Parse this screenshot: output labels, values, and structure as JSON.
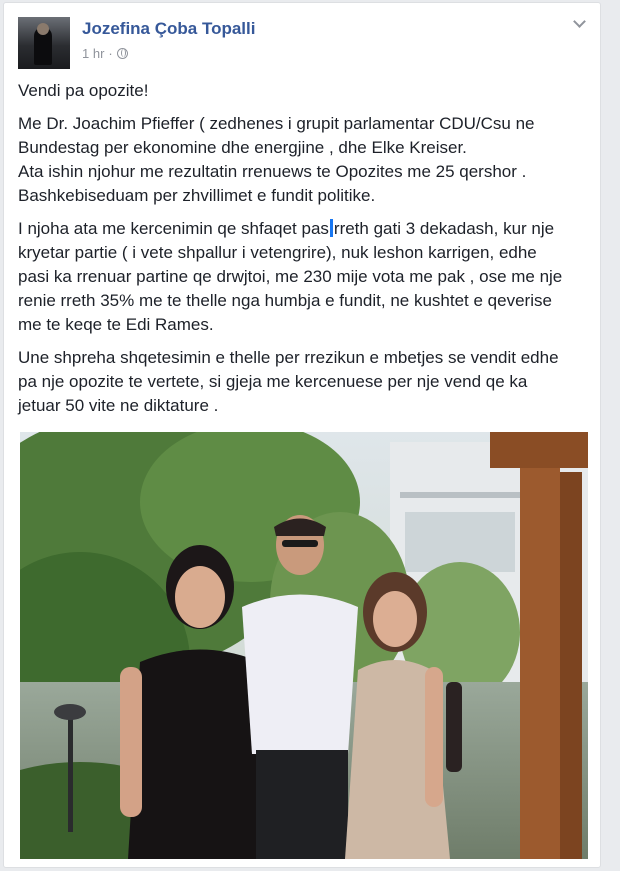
{
  "post": {
    "author": "Jozefina Çoba Topalli",
    "time": "1 hr",
    "separator": "·",
    "icons": {
      "privacy": "globe-icon",
      "options": "chevron-down-icon"
    },
    "paragraphs": {
      "p1": "Vendi pa opozite!",
      "p2_l1": "Me Dr. Joachim Pfieffer ( zedhenes i grupit parlamentar CDU/Csu ne",
      "p2_l2": "Bundestag per ekonomine dhe energjine , dhe Elke Kreiser.",
      "p2_l3": "Ata ishin njohur me rezultatin rrenuews te Opozites me 25 qershor .",
      "p2_l4": "Bashkebiseduam per zhvillimet e fundit politike.",
      "p3_l1a": "I njoha ata me kercenimin qe shfaqet pas",
      "p3_l1b": "rreth gati 3 dekadash, kur nje",
      "p3_l2": "kryetar partie ( i vete shpallur i vetengrire), nuk leshon karrigen, edhe",
      "p3_l3": "pasi ka rrenuar partine qe drwjtoi, me 230 mije vota me pak , ose me nje",
      "p3_l4": "renie rreth 35% me te thelle nga humbja e fundit, ne kushtet e qeverise",
      "p3_l5": "me te keqe te Edi Rames.",
      "p4_l1": "Une shpreha shqetesimin e thelle per rrezikun e mbetjes se vendit edhe",
      "p4_l2": "pa nje opozite te vertete, si gjeja me kercenuese per nje vend qe ka",
      "p4_l3": "jetuar 50 vite ne diktature ."
    }
  },
  "colors": {
    "author": "#365899",
    "meta": "#90949c",
    "text": "#1d2129",
    "background": "#e9ebee",
    "cursor": "#1877f2"
  }
}
